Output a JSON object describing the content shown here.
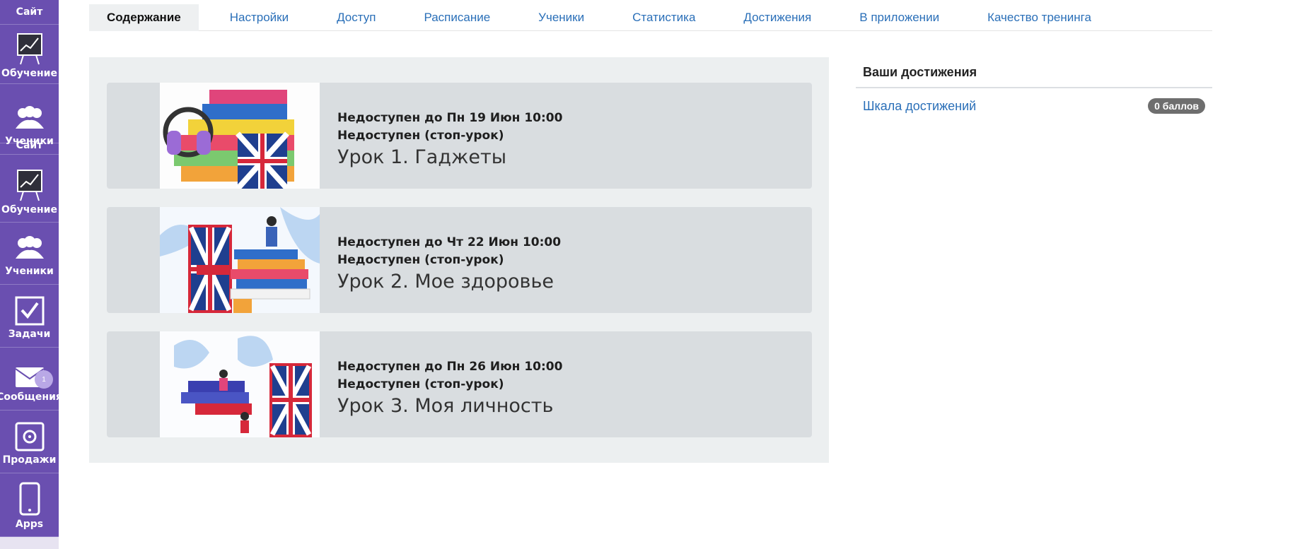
{
  "sidebar": {
    "items": [
      {
        "label": "Сайт",
        "icon": "site-icon"
      },
      {
        "label": "Обучение",
        "icon": "chart-board-icon"
      },
      {
        "label": "Ученики",
        "icon": "users-icon"
      },
      {
        "label": "Сайт",
        "icon": "site-icon"
      },
      {
        "label": "Обучение",
        "icon": "chart-board-icon"
      },
      {
        "label": "Ученики",
        "icon": "users-icon"
      },
      {
        "label": "Задачи",
        "icon": "checkbox-icon"
      },
      {
        "label": "Сообщения",
        "icon": "envelope-icon",
        "badge": "1"
      },
      {
        "label": "Продажи",
        "icon": "safe-icon"
      },
      {
        "label": "Apps",
        "icon": "phone-icon"
      }
    ]
  },
  "tabs": [
    {
      "label": "Содержание",
      "active": true
    },
    {
      "label": "Настройки"
    },
    {
      "label": "Доступ"
    },
    {
      "label": "Расписание"
    },
    {
      "label": "Ученики"
    },
    {
      "label": "Статистика"
    },
    {
      "label": "Достижения"
    },
    {
      "label": "В приложении"
    },
    {
      "label": "Качество тренинга"
    }
  ],
  "lessons": [
    {
      "status1": "Недоступен до Пн 19 Июн 10:00",
      "status2": "Недоступен (стоп-урок)",
      "title": "Урок 1. Гаджеты"
    },
    {
      "status1": "Недоступен до Чт 22 Июн 10:00",
      "status2": "Недоступен (стоп-урок)",
      "title": "Урок 2. Мое здоровье"
    },
    {
      "status1": "Недоступен до Пн 26 Июн 10:00",
      "status2": "Недоступен (стоп-урок)",
      "title": "Урок 3. Моя личность"
    }
  ],
  "achievements": {
    "heading": "Ваши достижения",
    "link": "Шкала достижений",
    "points": "0 баллов"
  },
  "colors": {
    "sidebar": "#6a4fb0",
    "link": "#2a6fb8",
    "panel": "#eceff0",
    "card": "#d9dde0"
  }
}
